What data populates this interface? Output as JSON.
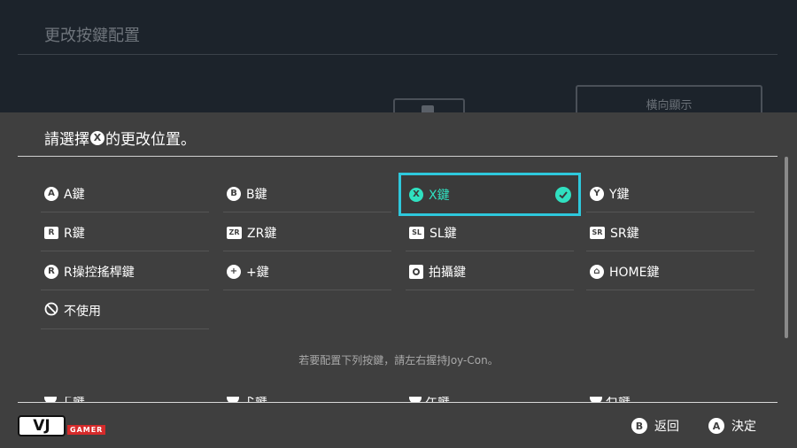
{
  "background": {
    "title": "更改按鍵配置",
    "landscape_button": "橫向顯示"
  },
  "prompt": {
    "before": "請選擇",
    "button_glyph": "X",
    "after": "的更改位置。"
  },
  "options": [
    {
      "icon": "A",
      "icon_name": "a-button-icon",
      "label": "A鍵"
    },
    {
      "icon": "B",
      "icon_name": "b-button-icon",
      "label": "B鍵"
    },
    {
      "icon": "X",
      "icon_name": "x-button-icon",
      "label": "X鍵",
      "selected": true
    },
    {
      "icon": "Y",
      "icon_name": "y-button-icon",
      "label": "Y鍵"
    },
    {
      "icon": "R",
      "icon_name": "r-button-icon",
      "label": "R鍵"
    },
    {
      "icon": "ZR",
      "icon_name": "zr-button-icon",
      "label": "ZR鍵"
    },
    {
      "icon": "SL",
      "icon_name": "sl-button-icon",
      "label": "SL鍵"
    },
    {
      "icon": "SR",
      "icon_name": "sr-button-icon",
      "label": "SR鍵"
    },
    {
      "icon": "R",
      "icon_name": "r-stick-icon",
      "label": "R操控搖桿鍵"
    },
    {
      "icon": "+",
      "icon_name": "plus-button-icon",
      "label": "+鍵"
    },
    {
      "icon": "",
      "icon_name": "capture-button-icon",
      "label": "拍攝鍵"
    },
    {
      "icon": "⌂",
      "icon_name": "home-button-icon",
      "label": "HOME鍵"
    },
    {
      "icon": "",
      "icon_name": "disable-icon",
      "label": "不使用"
    }
  ],
  "hint": "若要配置下列按鍵，請左右握持Joy-Con。",
  "partial_row": [
    "上鍵",
    "下鍵",
    "左鍵",
    "右鍵"
  ],
  "footer": {
    "back": {
      "glyph": "B",
      "label": "返回"
    },
    "confirm": {
      "glyph": "A",
      "label": "決定"
    }
  },
  "watermark": {
    "logo_text": "VJ",
    "sub_text": "GAMER"
  },
  "colors": {
    "accent": "#2ec8dc",
    "selected_text": "#30e0c0",
    "panel": "#3f3f3f"
  }
}
